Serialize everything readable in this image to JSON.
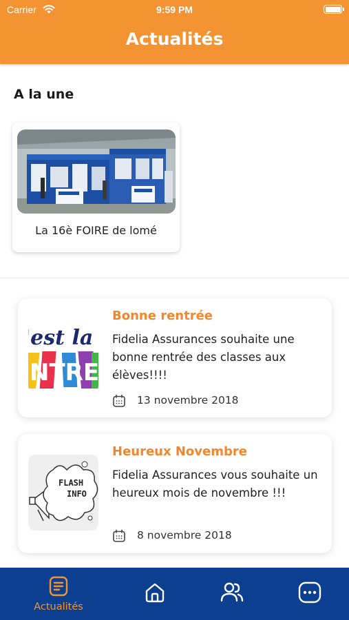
{
  "status_bar": {
    "carrier": "Carrier",
    "time": "9:59 PM"
  },
  "header": {
    "title": "Actualités"
  },
  "featured": {
    "section_title": "A la une",
    "items": [
      {
        "caption": "La 16è FOIRE de lomé"
      }
    ]
  },
  "news": [
    {
      "title": "Bonne rentrée",
      "text": "Fidelia Assurances souhaite une bonne rentrée des classes aux élèves!!!!",
      "date": "13 novembre 2018",
      "thumb_text_top": "'est la",
      "thumb_text_bottom": "NTRE"
    },
    {
      "title": "Heureux Novembre",
      "text": "Fidelia Assurances vous souhaite un heureux mois de novembre !!!",
      "date": "8 novembre 2018",
      "thumb_text_top": "FLASH",
      "thumb_text_bottom": "INFO"
    }
  ],
  "tabbar": {
    "active": "Actualités",
    "tabs": [
      {
        "label": "Actualités",
        "icon": "news-icon"
      },
      {
        "label": "",
        "icon": "home-icon"
      },
      {
        "label": "",
        "icon": "users-icon"
      },
      {
        "label": "",
        "icon": "more-icon"
      }
    ]
  },
  "colors": {
    "primary": "#f39332",
    "tabbar": "#0d3f91",
    "title_accent": "#f0872d"
  }
}
